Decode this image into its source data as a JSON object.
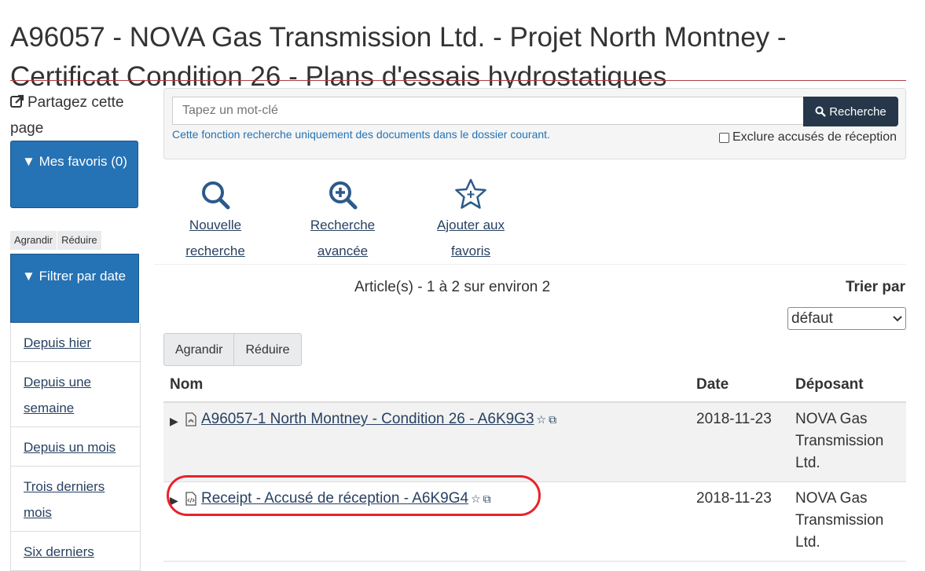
{
  "page": {
    "title": "A96057 - NOVA Gas Transmission Ltd. - Projet North Montney - Certificat Condition 26 - Plans d'essais hydrostatiques"
  },
  "sidebar": {
    "share_label": "Partagez cette page",
    "favorites_label": "Mes favoris (0)",
    "expand_label": "Agrandir",
    "collapse_label": "Réduire",
    "filter_label": "Filtrer par date",
    "filters": [
      "Depuis hier",
      "Depuis une semaine",
      "Depuis un mois",
      "Trois derniers mois",
      "Six derniers"
    ]
  },
  "search": {
    "placeholder": "Tapez un mot-clé",
    "button_label": "Recherche",
    "help_text": "Cette fonction recherche uniquement des documents dans le dossier courant.",
    "exclude_label": "Exclure accusés de réception"
  },
  "actions": {
    "new_search": "Nouvelle recherche",
    "advanced_search": "Recherche avancée",
    "add_favorites": "Ajouter aux favoris"
  },
  "results": {
    "count_text": "Article(s) - 1 à 2 sur environ 2",
    "sort_label": "Trier par",
    "sort_value": "défaut",
    "expand_label": "Agrandir",
    "collapse_label": "Réduire",
    "columns": [
      "Nom",
      "Date",
      "Déposant"
    ],
    "rows": [
      {
        "name": "A96057-1 North Montney - Condition 26 - A6K9G3",
        "date": "2018-11-23",
        "depositor": "NOVA Gas Transmission Ltd.",
        "icon": "pdf-file-icon"
      },
      {
        "name": "Receipt - Accusé de réception - A6K9G4",
        "date": "2018-11-23",
        "depositor": "NOVA Gas Transmission Ltd.",
        "icon": "code-file-icon"
      }
    ]
  },
  "colors": {
    "panel_blue": "#2572b4",
    "button_dark": "#26374a",
    "title_rule": "#af3c43",
    "highlight": "#e8222c"
  }
}
